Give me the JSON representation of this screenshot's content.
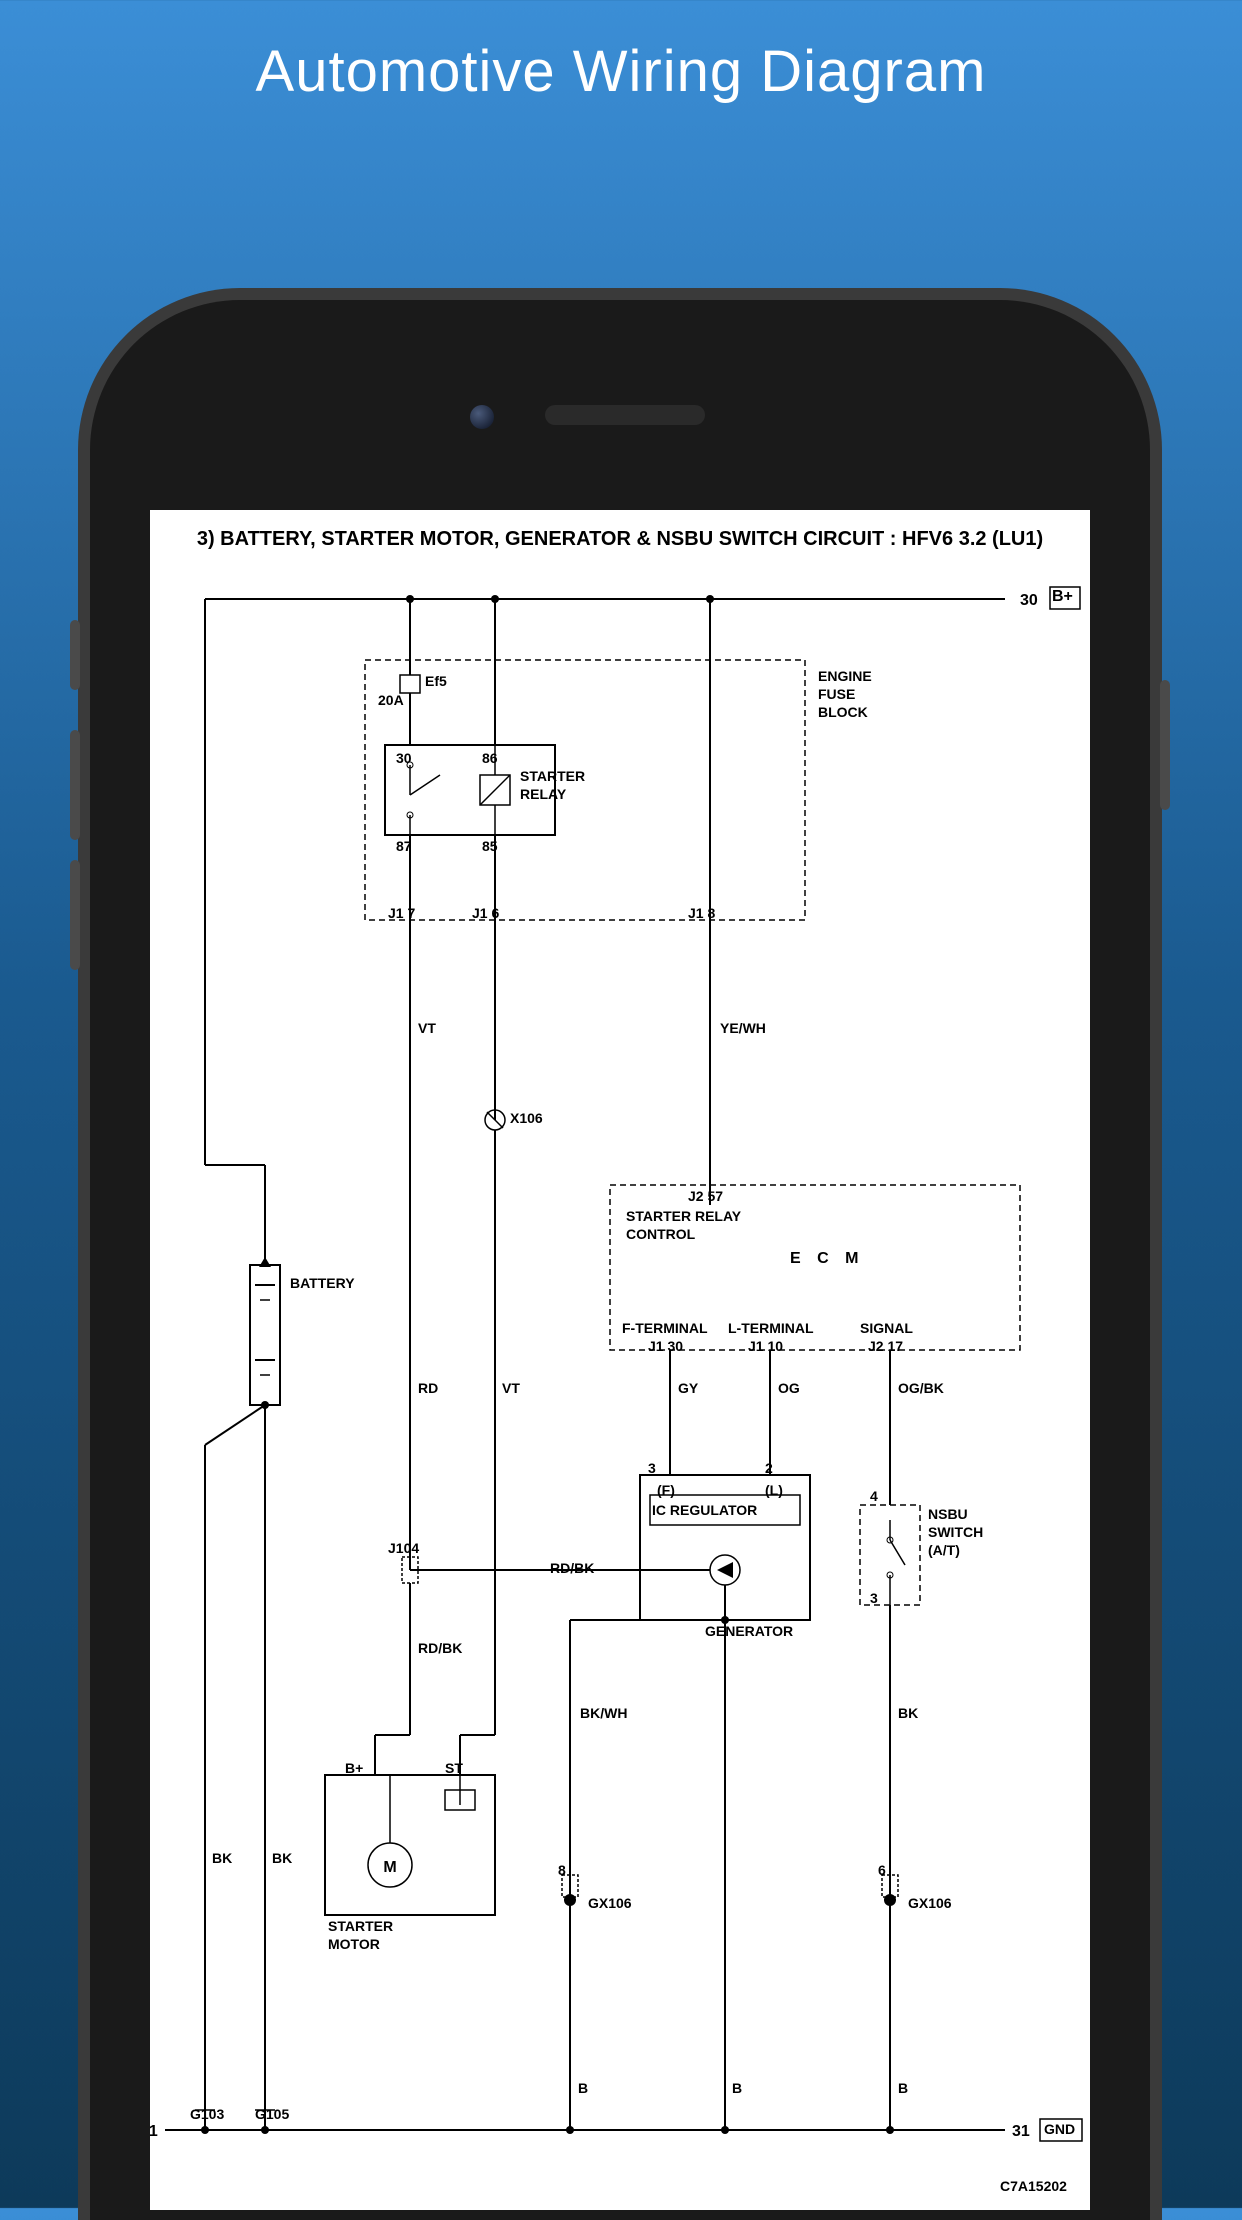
{
  "page_title": "Automotive Wiring Diagram",
  "diagram": {
    "title": "3) BATTERY, STARTER MOTOR, GENERATOR & NSBU SWITCH CIRCUIT : HFV6 3.2 (LU1)",
    "top_rail": {
      "terminal": "30",
      "label": "B+"
    },
    "bottom_rail": {
      "terminal": "31",
      "label": "GND"
    },
    "engine_fuse_block": {
      "label_line1": "ENGINE",
      "label_line2": "FUSE",
      "label_line3": "BLOCK",
      "fuse": {
        "name": "Ef5",
        "rating": "20A"
      },
      "starter_relay": {
        "label_line1": "STARTER",
        "label_line2": "RELAY",
        "pin30": "30",
        "pin86": "86",
        "pin87": "87",
        "pin85": "85"
      },
      "connectors": {
        "j1_7": "J1",
        "j1_7_pin": "7",
        "j1_6": "J1",
        "j1_6_pin": "6",
        "j1_8": "J1",
        "j1_8_pin": "8"
      }
    },
    "wire_colors": {
      "vt1": "VT",
      "vt2": "VT",
      "ye_wh": "YE/WH",
      "rd": "RD",
      "rd_bk1": "RD/BK",
      "rd_bk2": "RD/BK",
      "gy": "GY",
      "og": "OG",
      "og_bk": "OG/BK",
      "bk1": "BK",
      "bk2": "BK",
      "bk3": "BK",
      "bk_wh": "BK/WH",
      "b1": "B",
      "b2": "B",
      "b3": "B"
    },
    "connectors": {
      "x106": "X106",
      "j104": "J104",
      "gx106_1": "GX106",
      "gx106_2": "GX106"
    },
    "battery": {
      "label": "BATTERY"
    },
    "starter_motor": {
      "label_line1": "STARTER",
      "label_line2": "MOTOR",
      "terminal_bplus": "B+",
      "terminal_st": "ST",
      "motor_label": "M"
    },
    "ecm": {
      "label": "E C M",
      "starter_relay_control": "STARTER RELAY",
      "control": "CONTROL",
      "f_terminal": "F-TERMINAL",
      "l_terminal": "L-TERMINAL",
      "signal": "SIGNAL",
      "j2_57": "J2",
      "j2_57_pin": "57",
      "j1_30": "J1",
      "j1_30_pin": "30",
      "j1_10": "J1",
      "j1_10_pin": "10",
      "j2_17": "J2",
      "j2_17_pin": "17"
    },
    "generator": {
      "label": "GENERATOR",
      "ic_regulator": "IC REGULATOR",
      "pin_f": "(F)",
      "pin_l": "(L)",
      "pin3": "3",
      "pin2": "2"
    },
    "nsbu_switch": {
      "label_line1": "NSBU",
      "label_line2": "SWITCH",
      "label_line3": "(A/T)",
      "pin4": "4",
      "pin3": "3"
    },
    "grounds": {
      "g103": "G103",
      "g105": "G105",
      "pin8": "8",
      "pin6": "6"
    },
    "doc_number": "C7A15202"
  }
}
